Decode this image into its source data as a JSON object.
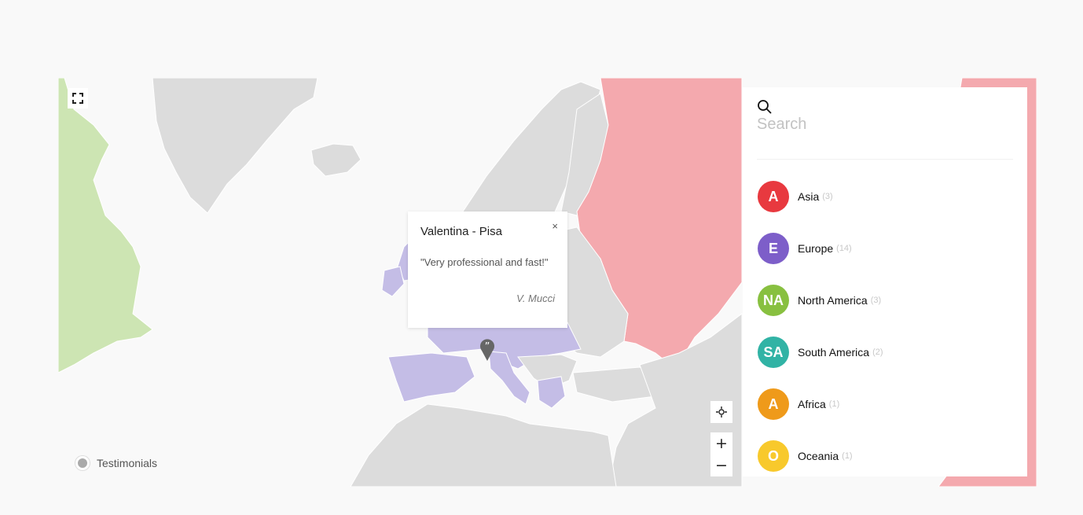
{
  "map": {
    "colors": {
      "water": "#f9f9f9",
      "land": "#dcdcdc",
      "border": "#ffffff",
      "north_america": "#cde5b3",
      "europe": "#c4bde6",
      "asia": "#f4a9ae",
      "marker": "#666666"
    },
    "controls": {
      "fullscreen_icon": "fullscreen-icon",
      "recenter_icon": "recenter-icon",
      "zoom_in": "+",
      "zoom_out": "−"
    },
    "marker_icon": "quote-marker-icon"
  },
  "popup": {
    "title": "Valentina - Pisa",
    "close": "×",
    "quote": "\"Very professional and fast!\"",
    "author": "V. Mucci"
  },
  "legend": {
    "label": "Testimonials"
  },
  "panel": {
    "search_icon": "search-icon",
    "search_placeholder": "Search",
    "search_value": "",
    "regions": [
      {
        "initials": "A",
        "name": "Asia",
        "count": "(3)",
        "color": "#e8393f"
      },
      {
        "initials": "E",
        "name": "Europe",
        "count": "(14)",
        "color": "#7d5ec9"
      },
      {
        "initials": "NA",
        "name": "North America",
        "count": "(3)",
        "color": "#88c040"
      },
      {
        "initials": "SA",
        "name": "South America",
        "count": "(2)",
        "color": "#31b3a5"
      },
      {
        "initials": "A",
        "name": "Africa",
        "count": "(1)",
        "color": "#ef9a1a"
      },
      {
        "initials": "O",
        "name": "Oceania",
        "count": "(1)",
        "color": "#f8c92c"
      }
    ]
  }
}
